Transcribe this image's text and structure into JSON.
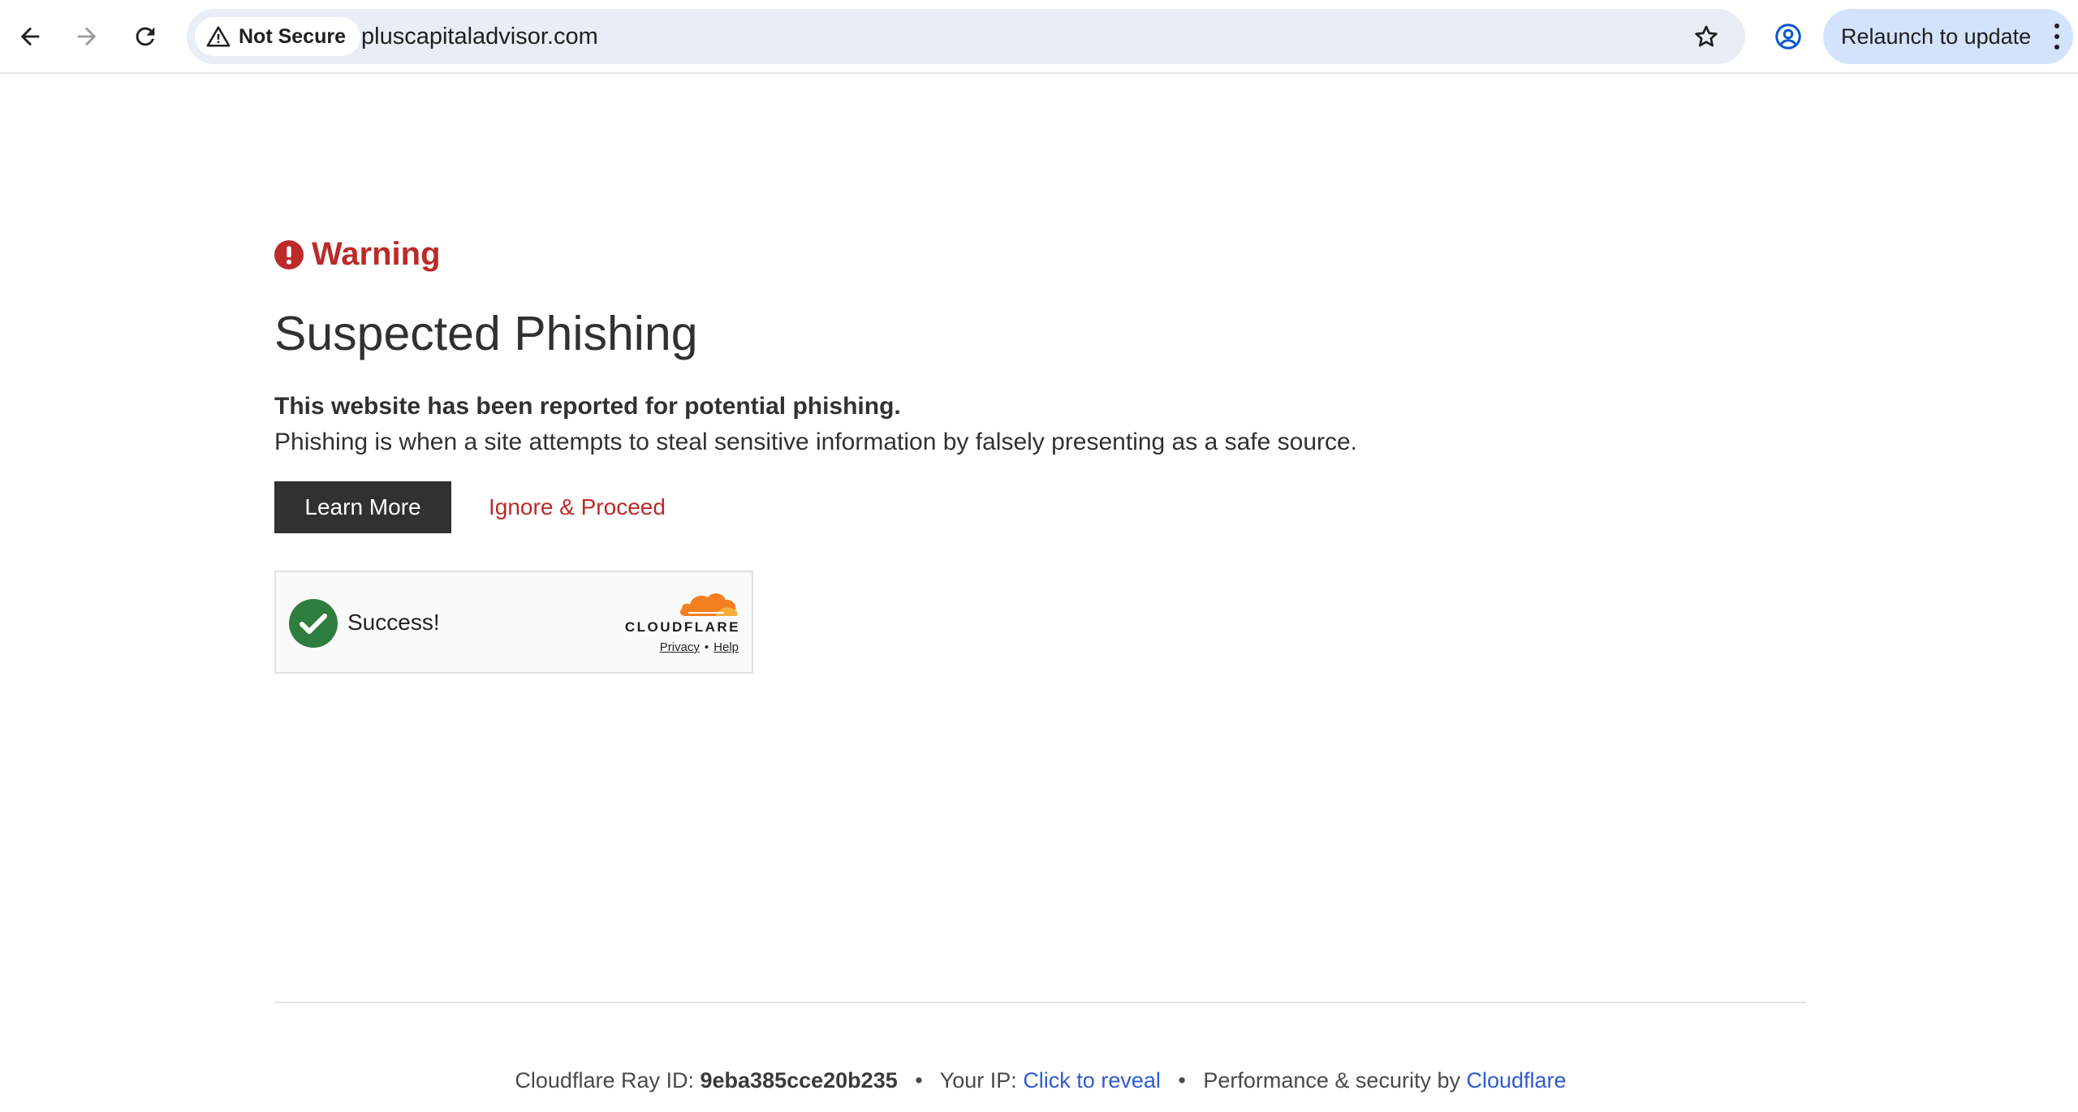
{
  "browser": {
    "security_label": "Not Secure",
    "url": "pluscapitaladvisor.com",
    "relaunch_label": "Relaunch to update"
  },
  "page": {
    "warning_label": "Warning",
    "title": "Suspected Phishing",
    "lead": "This website has been reported for potential phishing.",
    "description": "Phishing is when a site attempts to steal sensitive information by falsely presenting as a safe source.",
    "learn_more_label": "Learn More",
    "ignore_label": "Ignore & Proceed"
  },
  "turnstile": {
    "status": "Success!",
    "brand": "CLOUDFLARE",
    "privacy_label": "Privacy",
    "help_label": "Help",
    "separator": "•"
  },
  "footer": {
    "ray_label": "Cloudflare Ray ID:",
    "ray_id": "9eba385cce20b235",
    "ip_label": "Your IP:",
    "ip_link": "Click to reveal",
    "perf_label": "Performance & security by",
    "perf_link": "Cloudflare",
    "separator": "•"
  },
  "colors": {
    "warning_red": "#bc2a29",
    "dark_button": "#313131",
    "link_blue": "#2e5bd1",
    "success_green": "#2e7d3f",
    "cloudflare_orange": "#f38020"
  },
  "icons": {
    "back": "arrow-left-icon",
    "forward": "arrow-right-icon",
    "reload": "reload-icon",
    "security": "warning-triangle-icon",
    "bookmark": "star-icon",
    "profile": "account-circle-icon",
    "menu": "kebab-icon",
    "warning": "exclamation-circle-icon",
    "success": "check-circle-icon",
    "brand_logo": "cloudflare-cloud-icon"
  }
}
